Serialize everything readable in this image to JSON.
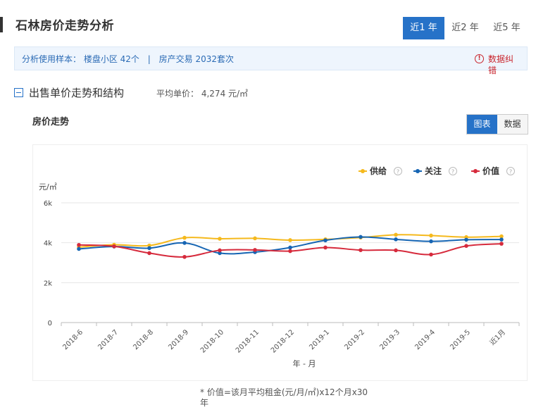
{
  "header": {
    "title": "石林房价走势分析",
    "range_tabs": [
      {
        "label": "近1 年",
        "active": true
      },
      {
        "label": "近2 年",
        "active": false
      },
      {
        "label": "近5 年",
        "active": false
      }
    ]
  },
  "sample": {
    "prefix": "分析使用样本：",
    "communities": "楼盘小区 42个",
    "separator": "|",
    "transactions": "房产交易 2032套次"
  },
  "report": {
    "icon": "info-icon",
    "label": "数据纠错"
  },
  "section": {
    "title": "出售单价走势和结构",
    "avg_label": "平均单价：",
    "avg_value": "4,274 元/㎡"
  },
  "chart_panel": {
    "label": "房价走势",
    "view_toggle": [
      {
        "label": "图表",
        "active": true
      },
      {
        "label": "数据",
        "active": false
      }
    ]
  },
  "footnote": "* 价值=该月平均租金(元/月/㎡)x12个月x30年",
  "colors": {
    "accent": "#2672c8",
    "supply": "#f5b91d",
    "attention": "#1665b3",
    "value": "#d62a3c",
    "grid": "#e6e6e6"
  },
  "chart_data": {
    "type": "line",
    "categories": [
      "2018-6",
      "2018-7",
      "2018-8",
      "2018-9",
      "2018-10",
      "2018-11",
      "2018-12",
      "2019-1",
      "2019-2",
      "2019-3",
      "2019-4",
      "2019-5",
      "近1月"
    ],
    "ylabel": "元/㎡",
    "xlabel": "年 - 月",
    "ylim": [
      0,
      6000
    ],
    "yticks": [
      0,
      2000,
      4000,
      6000
    ],
    "ytick_labels": [
      "0",
      "2k",
      "4k",
      "6k"
    ],
    "grid": true,
    "legend_position": "top-right",
    "series": [
      {
        "name": "供给",
        "color": "#f5b91d",
        "values": [
          3780,
          3900,
          3860,
          4250,
          4200,
          4220,
          4130,
          4170,
          4260,
          4400,
          4360,
          4280,
          4320
        ]
      },
      {
        "name": "关注",
        "color": "#1665b3",
        "values": [
          3690,
          3810,
          3730,
          3990,
          3480,
          3530,
          3760,
          4120,
          4290,
          4170,
          4070,
          4150,
          4160
        ]
      },
      {
        "name": "价值",
        "color": "#d62a3c",
        "values": [
          3890,
          3820,
          3480,
          3290,
          3620,
          3640,
          3580,
          3760,
          3630,
          3620,
          3410,
          3840,
          3950
        ]
      }
    ],
    "legend_help_icon": "question-icon"
  }
}
